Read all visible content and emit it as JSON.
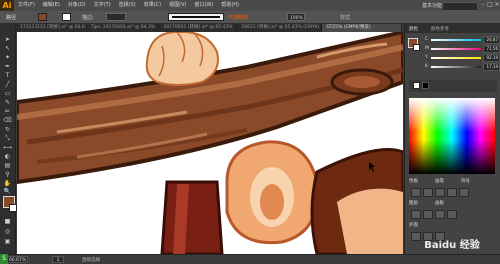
{
  "app": {
    "logo": "Ai"
  },
  "menu": [
    "文件(F)",
    "编辑(E)",
    "对象(O)",
    "文字(T)",
    "选择(S)",
    "效果(C)",
    "视图(V)",
    "窗口(W)",
    "帮助(H)"
  ],
  "workspace_label": "基本功能",
  "control_bar": {
    "path_label": "路径",
    "stroke_label": "描边:",
    "style_label": "不透明度",
    "opacity_value": "100%",
    "align_hint": "样式"
  },
  "tabs": [
    "173113115 [转换].ai* @ 66.67%",
    "Tips: 20170601.ai* @ 64.3%",
    "20170601 [转换].ai* @ 65.43%",
    "26621 [转换].ai* @ 65.43% (CMYK)",
    "GT25% (CMYK/预览)"
  ],
  "active_tab": 4,
  "panel": {
    "tab_color": "颜色",
    "tab_guide": "颜色参考",
    "sliders": [
      {
        "name": "C",
        "value": "26.87",
        "color": "#00b7eb"
      },
      {
        "name": "M",
        "value": "71.56",
        "color": "#e6007e"
      },
      {
        "name": "Y",
        "value": "92.19",
        "color": "#ffe100"
      },
      {
        "name": "K",
        "value": "17.19",
        "color": "#222222"
      }
    ],
    "swatch_label": "色板",
    "brushes_label": "画笔",
    "symbols_label": "符号",
    "layers_label": "图层",
    "artboards_label": "画板",
    "appearance_label": "外观"
  },
  "status": {
    "zoom": "66.67%",
    "artboard": "1",
    "text": "直接选择"
  },
  "watermark": "Baidu 经验",
  "colors": {
    "fill": "#8a4a2a",
    "branch_dark": "#6b3318",
    "branch_mid": "#8a4a2a",
    "branch_light": "#b8744a",
    "skin": "#f5c9a0",
    "skin_dark": "#d9905a",
    "trunk": "#7a1f14",
    "accent": "#ff9a00"
  }
}
